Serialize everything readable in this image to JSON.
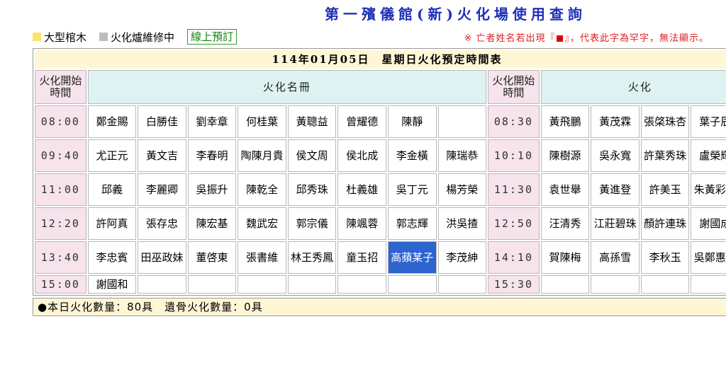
{
  "page_title": "第一殯儀館(新)火化場使用查詢",
  "legend": {
    "large_coffin": "大型棺木",
    "under_repair": "火化爐維修中",
    "book_online": "線上預訂"
  },
  "notice": {
    "prefix": "※ 亡者姓名若出現『",
    "suffix": "』，代表此字為罕字，無法顯示。"
  },
  "schedule": {
    "heading": "114年01月05日　星期日火化預定時間表",
    "time_header": "火化開始時間",
    "names_header": "火化名冊",
    "names_header_right": "火化",
    "rows": [
      {
        "time_left": "08:00",
        "left": [
          "鄭金賜",
          "白勝佳",
          "劉幸章",
          "何桂葉",
          "黃聰益",
          "曾耀德",
          "陳靜",
          ""
        ],
        "time_right": "08:30",
        "right": [
          "黃飛鵬",
          "黃茂霖",
          "張棨珠杏",
          "葉子辰"
        ]
      },
      {
        "time_left": "09:40",
        "left": [
          "尤正元",
          "黃文吉",
          "李春明",
          "陶陳月貴",
          "侯文周",
          "侯北成",
          "李金橫",
          "陳瑞恭"
        ],
        "time_right": "10:10",
        "right": [
          "陳樹源",
          "吳永寬",
          "許葉秀珠",
          "盧榮輝"
        ]
      },
      {
        "time_left": "11:00",
        "left": [
          "邱義",
          "李麗卿",
          "吳振升",
          "陳乾全",
          "邱秀珠",
          "杜義雄",
          "吳丁元",
          "楊芳榮"
        ],
        "time_right": "11:30",
        "right": [
          "袁世舉",
          "黃進登",
          "許美玉",
          "朱黃彩香"
        ]
      },
      {
        "time_left": "12:20",
        "left": [
          "許阿真",
          "張存忠",
          "陳宏基",
          "魏武宏",
          "郭宗儀",
          "陳颯蓉",
          "郭志輝",
          "洪吳揸"
        ],
        "time_right": "12:50",
        "right": [
          "汪清秀",
          "江莊碧珠",
          "顏許連珠",
          "謝國成"
        ]
      },
      {
        "time_left": "13:40",
        "left": [
          "李忠賓",
          "田巫政妹",
          "董啓東",
          "張書維",
          "林王秀鳳",
          "童玉招",
          "高蘋某子",
          "李茂紳"
        ],
        "time_right": "14:10",
        "right": [
          "賀陳梅",
          "高孫雪",
          "李秋玉",
          "吳鄭惠津"
        ]
      },
      {
        "time_left": "15:00",
        "left": [
          "謝國和",
          "",
          "",
          "",
          "",
          "",
          "",
          ""
        ],
        "time_right": "15:30",
        "right": [
          "",
          "",
          "",
          ""
        ]
      }
    ]
  },
  "footer": {
    "bullet": "●",
    "text": "本日火化數量：80具　遺骨火化數量：0具"
  },
  "colors": {
    "title_blue": "#1d2fb8",
    "notice_red": "#e02020",
    "time_pink": "#f6e3ec",
    "header_teal": "#dff2f2",
    "heading_cream": "#fff6d6",
    "selection_blue": "#2e64d0"
  }
}
